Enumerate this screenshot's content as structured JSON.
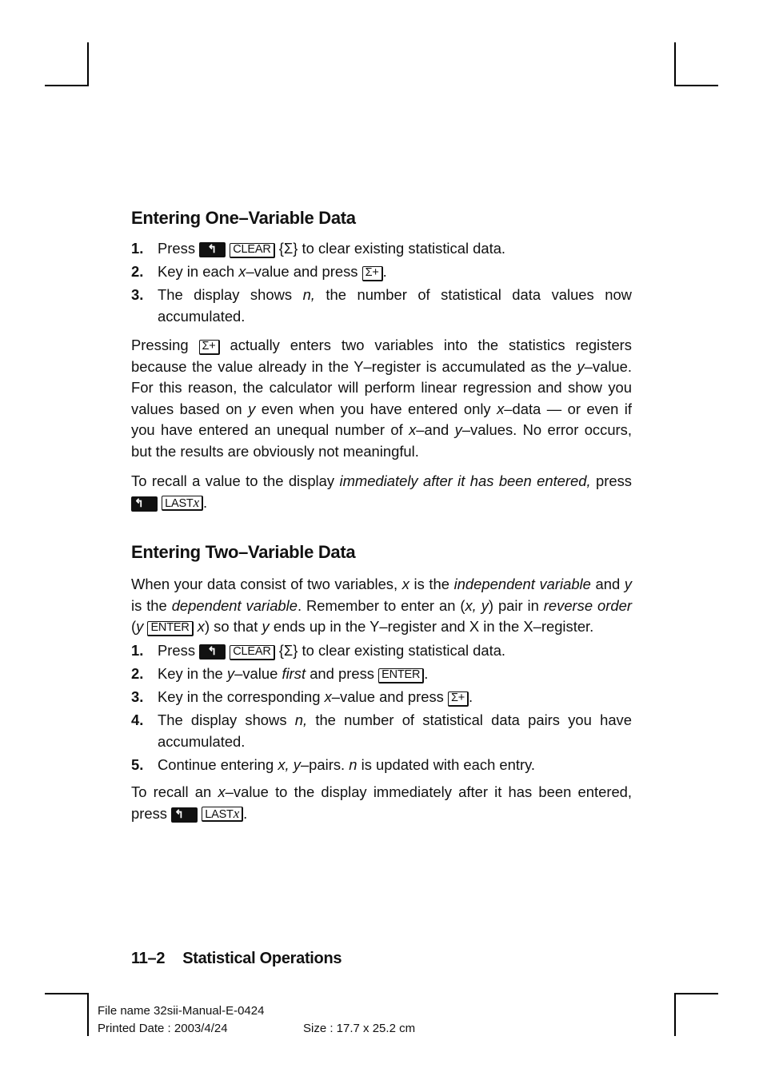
{
  "section1": {
    "heading": "Entering One–Variable Data",
    "steps": [
      {
        "num": "1.",
        "pre": "Press",
        "keys": [
          "shift",
          "CLEAR"
        ],
        "post": "{Σ} to clear existing statistical data."
      },
      {
        "num": "2.",
        "pre": "Key in each",
        "var": "x",
        "mid": "–value and press",
        "key": "Σ+",
        "post": "."
      },
      {
        "num": "3.",
        "line1_pre": "The display shows",
        "var": "n,",
        "line1_post": "the number of statistical data values now",
        "line2": "accumulated."
      }
    ],
    "para1": {
      "t1": "Pressing",
      "key": "Σ+",
      "t2": "actually enters two variables into the statistics registers because the value already in the Y–register is accumulated as the",
      "v1": "y",
      "t3": "–value. For this reason, the calculator will perform linear regression and show you values based on",
      "v2": "y",
      "t4": "even when you have entered only",
      "v3": "x",
      "t5": "–data — or even if you have entered an unequal number of",
      "v4": "x",
      "t6": "–and",
      "v5": "y",
      "t7": "–values. No error occurs, but the results are obviously not meaningful."
    },
    "para2": {
      "t1": "To recall a value to the display",
      "em": "immediately after it has been entered,",
      "t2": "press",
      "key_shift": "↰",
      "key_last": "LAST",
      "key_last_var": "x",
      "end": "."
    }
  },
  "section2": {
    "heading": "Entering Two–Variable Data",
    "intro": {
      "t1": "When your data consist of two variables,",
      "v1": "x",
      "t2": "is the",
      "e1": "independent variable",
      "t3": "and",
      "v2": "y",
      "t4": "is the",
      "e2": "dependent variable",
      "t5": ". Remember to enter an (",
      "v3": "x, y",
      "t6": ") pair in",
      "e3": "reverse order",
      "t7": "(",
      "v4": "y",
      "key": "ENTER",
      "v5": "x",
      "t8": ") so that",
      "v6": "y",
      "t9": "ends up in the Y–register and X in the X–register."
    },
    "steps": [
      {
        "num": "1.",
        "pre": "Press",
        "keys": [
          "shift",
          "CLEAR"
        ],
        "post": "{Σ} to clear existing statistical data."
      },
      {
        "num": "2.",
        "pre": "Key in the",
        "var": "y",
        "mid": "–value",
        "em": "first",
        "mid2": "and press",
        "key": "ENTER",
        "post": "."
      },
      {
        "num": "3.",
        "pre": "Key in the corresponding",
        "var": "x",
        "mid": "–value and press",
        "key": "Σ+",
        "post": "."
      },
      {
        "num": "4.",
        "line1_pre": "The display shows",
        "var": "n,",
        "line1_post": "the number of statistical data pairs you have",
        "line2": "accumulated."
      },
      {
        "num": "5.",
        "pre": "Continue entering",
        "var": "x, y",
        "mid": "–pairs.",
        "var2": "n",
        "post": "is updated with each entry."
      }
    ],
    "para": {
      "t1": "To recall an",
      "v1": "x",
      "t2": "–value to the display immediately after it has been entered,",
      "t3": "press",
      "key_last": "LAST",
      "key_last_var": "x",
      "end": "."
    }
  },
  "keys": {
    "shift_glyph": "↰",
    "clear": "CLEAR"
  },
  "footer": {
    "page_number": "11–2",
    "chapter": "Statistical Operations"
  },
  "print_info": {
    "file_name": "File name 32sii-Manual-E-0424",
    "printed_date": "Printed Date : 2003/4/24",
    "size": "Size : 17.7 x 25.2 cm"
  }
}
